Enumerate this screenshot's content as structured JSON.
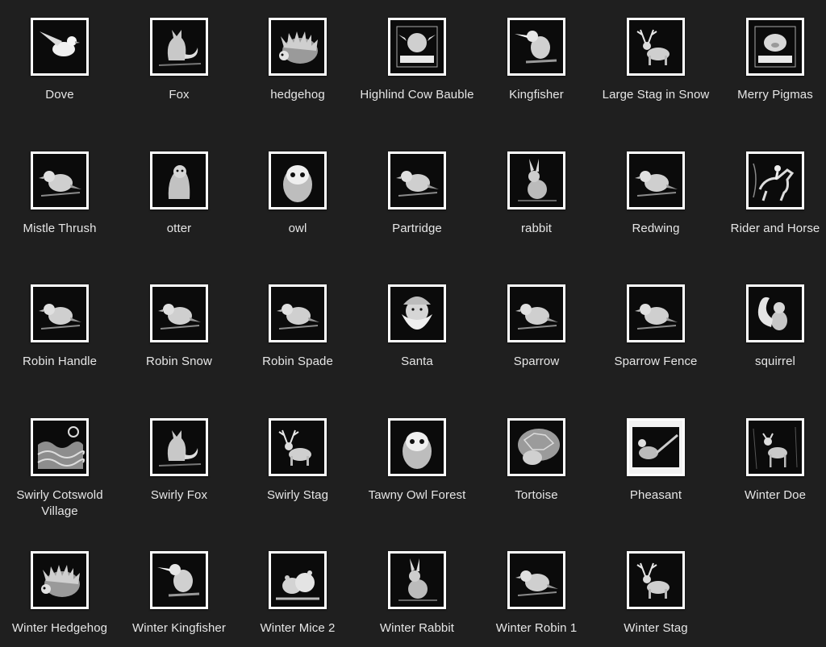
{
  "items": [
    {
      "label": "Dove",
      "icon": "dove-icon"
    },
    {
      "label": "Fox",
      "icon": "fox-icon"
    },
    {
      "label": "hedgehog",
      "icon": "hedgehog-icon"
    },
    {
      "label": "Highlind Cow Bauble",
      "icon": "cow-bauble-icon"
    },
    {
      "label": "Kingfisher",
      "icon": "kingfisher-icon"
    },
    {
      "label": "Large Stag in Snow",
      "icon": "stag-icon"
    },
    {
      "label": "Merry Pigmas",
      "icon": "pig-bauble-icon"
    },
    {
      "label": "Mistle Thrush",
      "icon": "bird-icon"
    },
    {
      "label": "otter",
      "icon": "otter-icon"
    },
    {
      "label": "owl",
      "icon": "owl-icon"
    },
    {
      "label": "Partridge",
      "icon": "bird-icon"
    },
    {
      "label": "rabbit",
      "icon": "rabbit-icon"
    },
    {
      "label": "Redwing",
      "icon": "bird-icon"
    },
    {
      "label": "Rider and Horse",
      "icon": "horse-icon"
    },
    {
      "label": "Robin Handle",
      "icon": "bird-icon"
    },
    {
      "label": "Robin Snow",
      "icon": "bird-icon"
    },
    {
      "label": "Robin Spade",
      "icon": "bird-icon"
    },
    {
      "label": "Santa",
      "icon": "santa-icon"
    },
    {
      "label": "Sparrow",
      "icon": "bird-icon"
    },
    {
      "label": "Sparrow Fence",
      "icon": "bird-icon"
    },
    {
      "label": "squirrel",
      "icon": "squirrel-icon"
    },
    {
      "label": "Swirly Cotswold Village",
      "icon": "village-icon"
    },
    {
      "label": "Swirly Fox",
      "icon": "fox-icon"
    },
    {
      "label": "Swirly Stag",
      "icon": "stag-icon"
    },
    {
      "label": "Tawny Owl Forest",
      "icon": "owl-icon"
    },
    {
      "label": "Tortoise",
      "icon": "tortoise-icon"
    },
    {
      "label": "Pheasant",
      "icon": "pheasant-icon"
    },
    {
      "label": "Winter Doe",
      "icon": "deer-icon"
    },
    {
      "label": "Winter Hedgehog",
      "icon": "hedgehog-icon"
    },
    {
      "label": "Winter Kingfisher",
      "icon": "kingfisher-icon"
    },
    {
      "label": "Winter Mice 2",
      "icon": "mice-icon"
    },
    {
      "label": "Winter Rabbit",
      "icon": "rabbit-icon"
    },
    {
      "label": "Winter Robin 1",
      "icon": "bird-icon"
    },
    {
      "label": "Winter Stag",
      "icon": "stag-icon"
    }
  ]
}
